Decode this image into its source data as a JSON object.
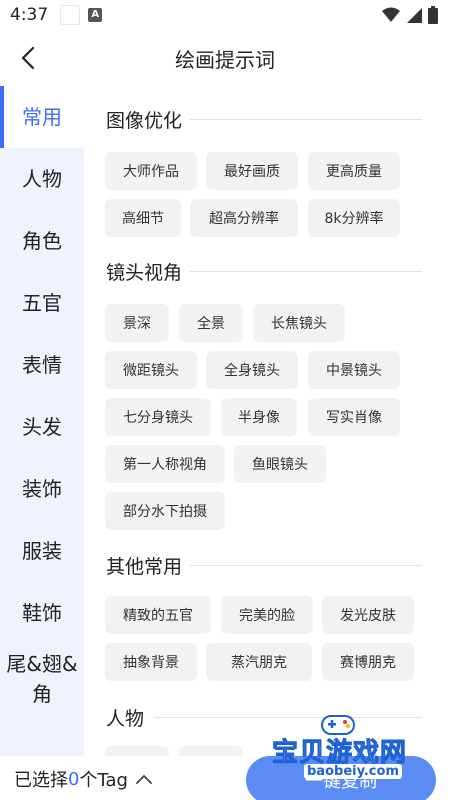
{
  "status_bar": {
    "time": "4:37"
  },
  "header": {
    "title": "绘画提示词"
  },
  "sidebar": {
    "items": [
      {
        "label": "常用",
        "active": true
      },
      {
        "label": "人物"
      },
      {
        "label": "角色"
      },
      {
        "label": "五官"
      },
      {
        "label": "表情"
      },
      {
        "label": "头发"
      },
      {
        "label": "装饰"
      },
      {
        "label": "服装"
      },
      {
        "label": "鞋饰"
      },
      {
        "label": "尾&翅&\n角"
      }
    ]
  },
  "sections": [
    {
      "title": "图像优化",
      "tags": [
        "大师作品",
        "最好画质",
        "更高质量",
        "高细节",
        "超高分辨率",
        "8k分辨率"
      ]
    },
    {
      "title": "镜头视角",
      "tags": [
        "景深",
        "全景",
        "长焦镜头",
        "微距镜头",
        "全身镜头",
        "中景镜头",
        "七分身镜头",
        "半身像",
        "写实肖像",
        "第一人称视角",
        "鱼眼镜头",
        "部分水下拍摄"
      ]
    },
    {
      "title": "其他常用",
      "tags": [
        "精致的五官",
        "完美的脸",
        "发光皮肤",
        "抽象背景",
        "蒸汽朋克",
        "赛博朋克"
      ]
    },
    {
      "title": "人物",
      "tags": []
    }
  ],
  "bottom_bar": {
    "prefix": "已选择",
    "count": "0",
    "suffix": "个Tag",
    "confirm_label": "一键复制"
  },
  "watermark": {
    "cn": "宝贝游戏网",
    "en": "baobeiy.com"
  },
  "colors": {
    "accent": "#3d6cf6",
    "sidebar_bg": "#eef3fe",
    "chip_bg": "#f2f2f2",
    "button": "#5b8cf3"
  }
}
